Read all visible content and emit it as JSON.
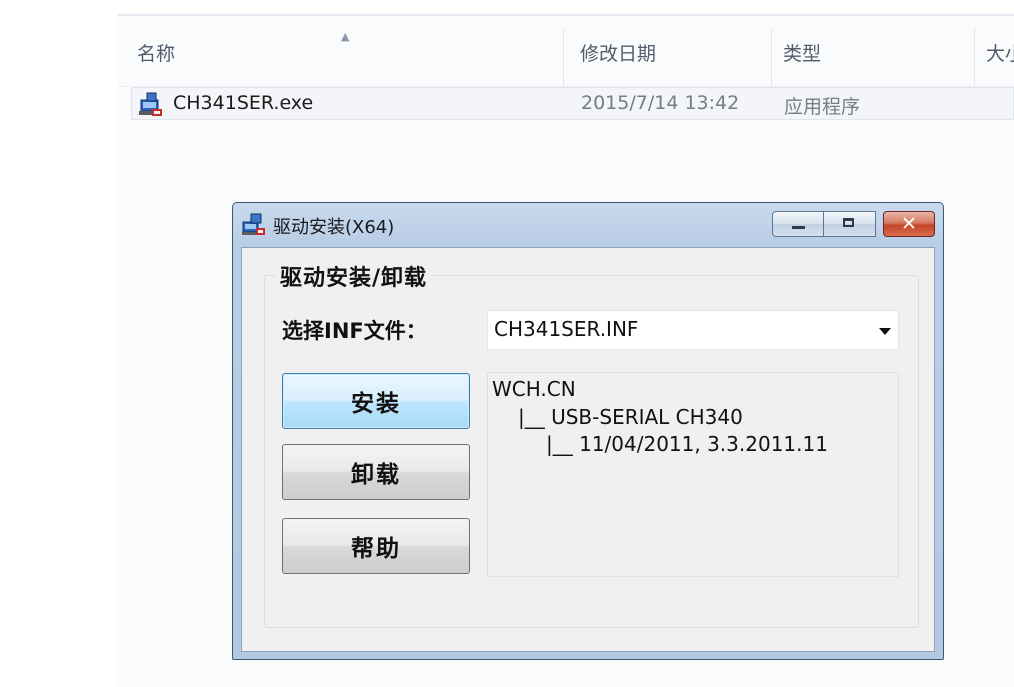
{
  "explorer": {
    "columns": {
      "name": "名称",
      "modified": "修改日期",
      "type": "类型",
      "size": "大小"
    },
    "sort_indicator": "▲",
    "files": [
      {
        "name": "CH341SER.exe",
        "modified": "2015/7/14 13:42",
        "type": "应用程序",
        "icon": "installer-exe-icon"
      }
    ]
  },
  "dialog": {
    "title": "驱动安装(X64)",
    "icon": "driver-install-icon",
    "caption_buttons": {
      "minimize": "minimize",
      "maximize": "maximize",
      "close": "✕"
    },
    "group_title": "驱动安装/卸载",
    "inf_label": "选择INF文件：",
    "inf_selected": "CH341SER.INF",
    "buttons": {
      "install": "安装",
      "uninstall": "卸载",
      "help": "帮助"
    },
    "info_lines": [
      "WCH.CN",
      "|__ USB-SERIAL CH340",
      "|__ 11/04/2011, 3.3.2011.11"
    ]
  },
  "colors": {
    "dialog_frame": "#b9cde6",
    "close_button": "#c54527",
    "focused_button_border": "#3c7fb1"
  }
}
